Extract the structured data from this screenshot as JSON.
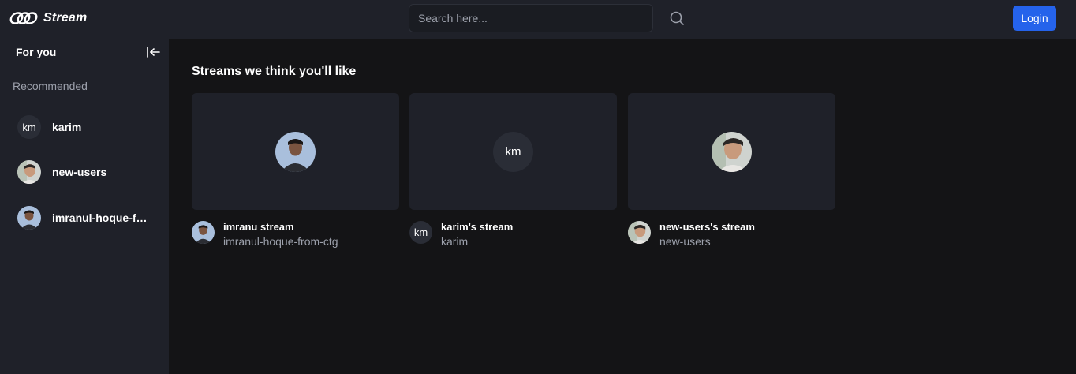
{
  "header": {
    "brand_name": "Stream",
    "search_placeholder": "Search here...",
    "login_label": "Login"
  },
  "sidebar": {
    "title": "For you",
    "section_label": "Recommended",
    "items": [
      {
        "name": "karim",
        "avatar": "km"
      },
      {
        "name": "new-users",
        "avatar": "photo"
      },
      {
        "name": "imranul-hoque-from-ctg",
        "avatar": "photo"
      }
    ]
  },
  "main": {
    "section_title": "Streams we think you'll like",
    "streams": [
      {
        "title": "imranu stream",
        "username": "imranul-hoque-from-ctg",
        "avatar": "photo"
      },
      {
        "title": "karim's stream",
        "username": "karim",
        "avatar": "km"
      },
      {
        "title": "new-users's stream",
        "username": "new-users",
        "avatar": "photo"
      }
    ]
  },
  "colors": {
    "background": "#141416",
    "panel": "#1f2129",
    "accent": "#2563eb",
    "muted_text": "#9ca0ab"
  },
  "icons": [
    "logo-icon",
    "search-icon",
    "collapse-sidebar-icon"
  ]
}
